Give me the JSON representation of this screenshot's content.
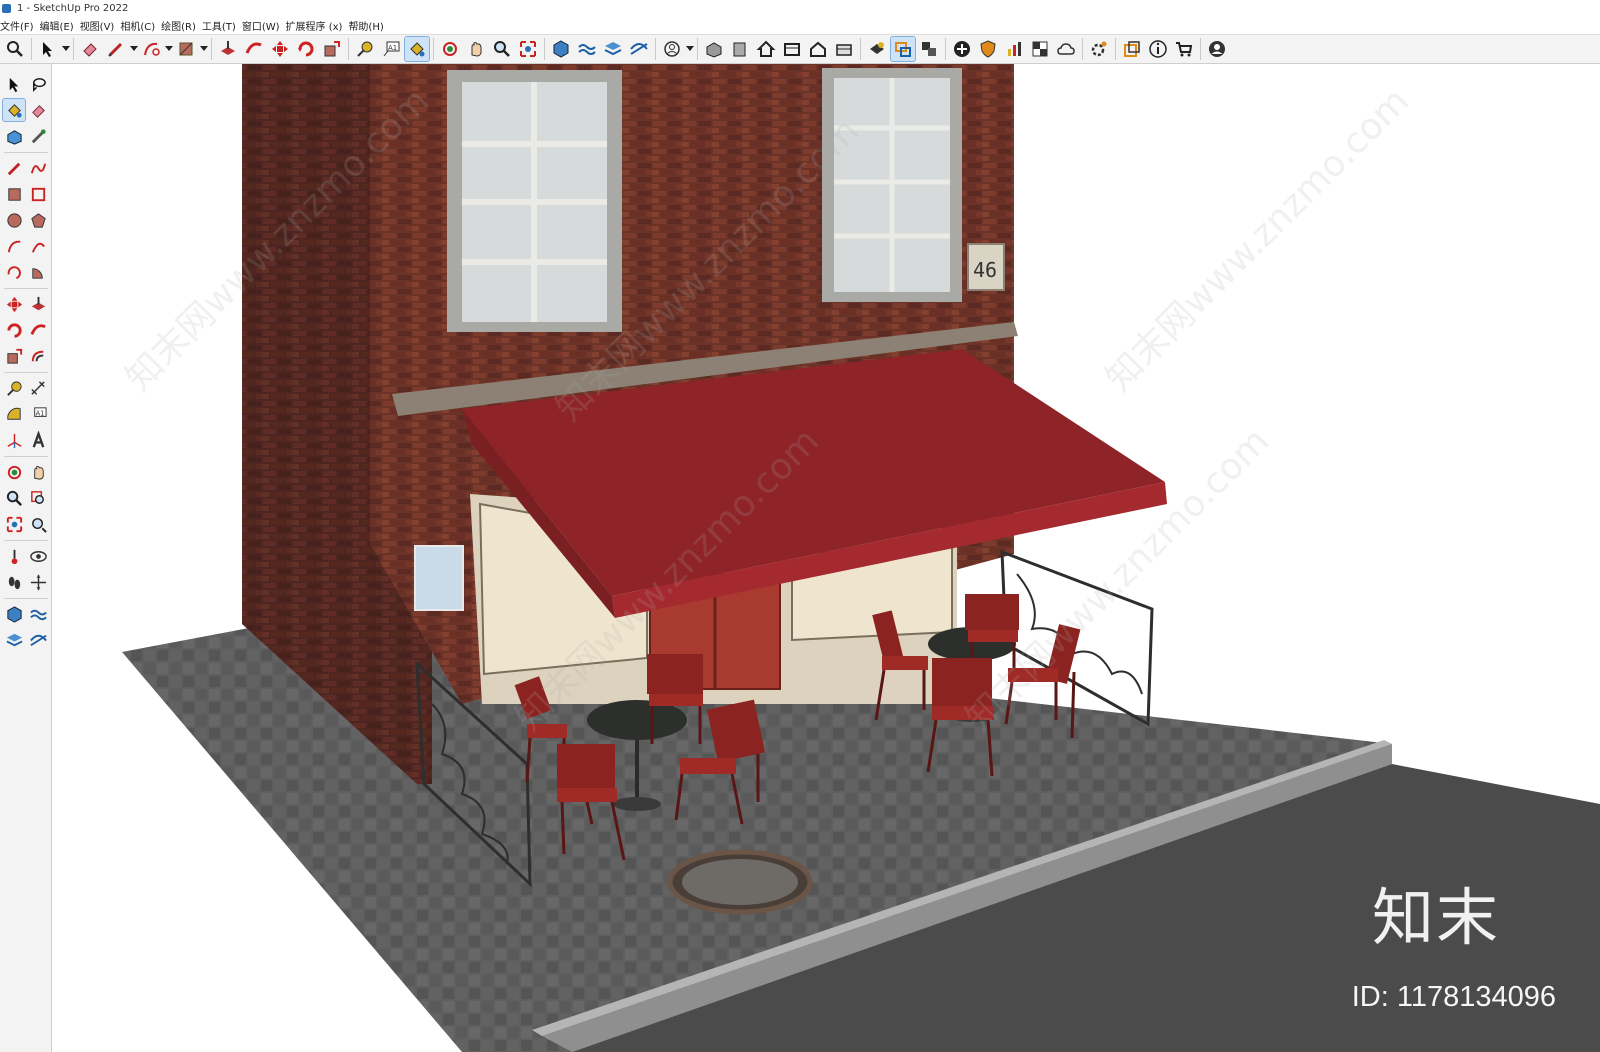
{
  "window": {
    "title": "1 - SketchUp Pro 2022"
  },
  "menu": {
    "items": [
      "文件(F)",
      "编辑(E)",
      "视图(V)",
      "相机(C)",
      "绘图(R)",
      "工具(T)",
      "窗口(W)",
      "扩展程序 (x)",
      "帮助(H)"
    ]
  },
  "toolbar": {
    "icons": [
      "search-icon",
      "select-icon",
      "eraser-icon",
      "pencil-icon",
      "arc-icon",
      "paint-icon",
      "push-pull-icon",
      "follow-me-icon",
      "move-icon",
      "rotate-icon",
      "scale-icon",
      "tape-measure-icon",
      "text-icon",
      "paint-bucket-icon",
      "orbit-icon",
      "pan-icon",
      "zoom-icon",
      "zoom-extents-icon",
      "geo-icon",
      "sandbox-icon",
      "layers-icon",
      "sandbox-smoove-icon",
      "profile-icon",
      "iso-view-icon",
      "front-view-icon",
      "home-view-icon",
      "top-view-icon",
      "house-view-icon",
      "back-view-icon",
      "component-icon",
      "group-icon",
      "section-icon",
      "add-icon",
      "shield-icon",
      "chart-icon",
      "checker-icon",
      "cloud-icon",
      "settings-icon",
      "outliner-icon",
      "info-icon",
      "cart-icon",
      "account-icon"
    ]
  },
  "viewport": {
    "house_number": "46",
    "brand_colors": {
      "awning": "#8e2428",
      "brick": "#6b3228",
      "pavement": "#5a5a5a",
      "road": "#4b4b4b"
    }
  },
  "watermark": {
    "logo": "知末",
    "id": "ID: 1178134096",
    "diagonal_text": "知末网www.znzmo.com"
  }
}
